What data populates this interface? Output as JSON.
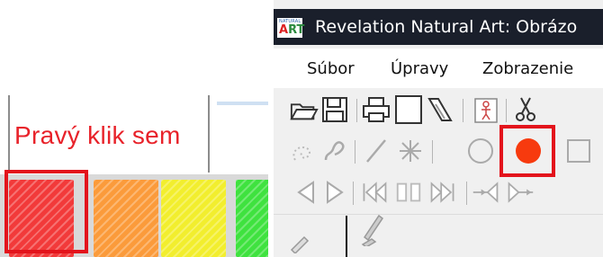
{
  "left_panel": {
    "caption": "Pravý klik sem",
    "swatches": [
      {
        "name": "red",
        "color": "#f23a3a"
      },
      {
        "name": "orange",
        "color": "#fb9b3b"
      },
      {
        "name": "yellow",
        "color": "#f2ee2e"
      },
      {
        "name": "green",
        "color": "#3fe23f"
      }
    ],
    "highlight_color": "#e3141c"
  },
  "app": {
    "logo_top": "NATURAL",
    "logo_main_a": "A",
    "logo_main_rt": "RT",
    "title": "Revelation Natural Art: Obrázo",
    "menu": [
      "Súbor",
      "Úpravy",
      "Zobrazenie"
    ]
  },
  "toolbar_icons": {
    "row1": [
      "open-folder-icon",
      "save-disk-icon",
      "print-icon",
      "blank-page-icon",
      "stamp-icon",
      "figure-template-icon",
      "scissors-icon"
    ],
    "row2": [
      "dotted-loop-icon",
      "curve-icon",
      "line-icon",
      "star-burst-icon",
      "circle-icon",
      "filled-circle-icon",
      "rectangle-icon"
    ],
    "row3": [
      "triangle-left-icon",
      "triangle-right-icon",
      "rewind-icon",
      "pause-frames-icon",
      "fast-forward-icon",
      "shrink-arrows-icon",
      "expand-arrows-icon"
    ]
  },
  "accent_color": "#f73a0e"
}
